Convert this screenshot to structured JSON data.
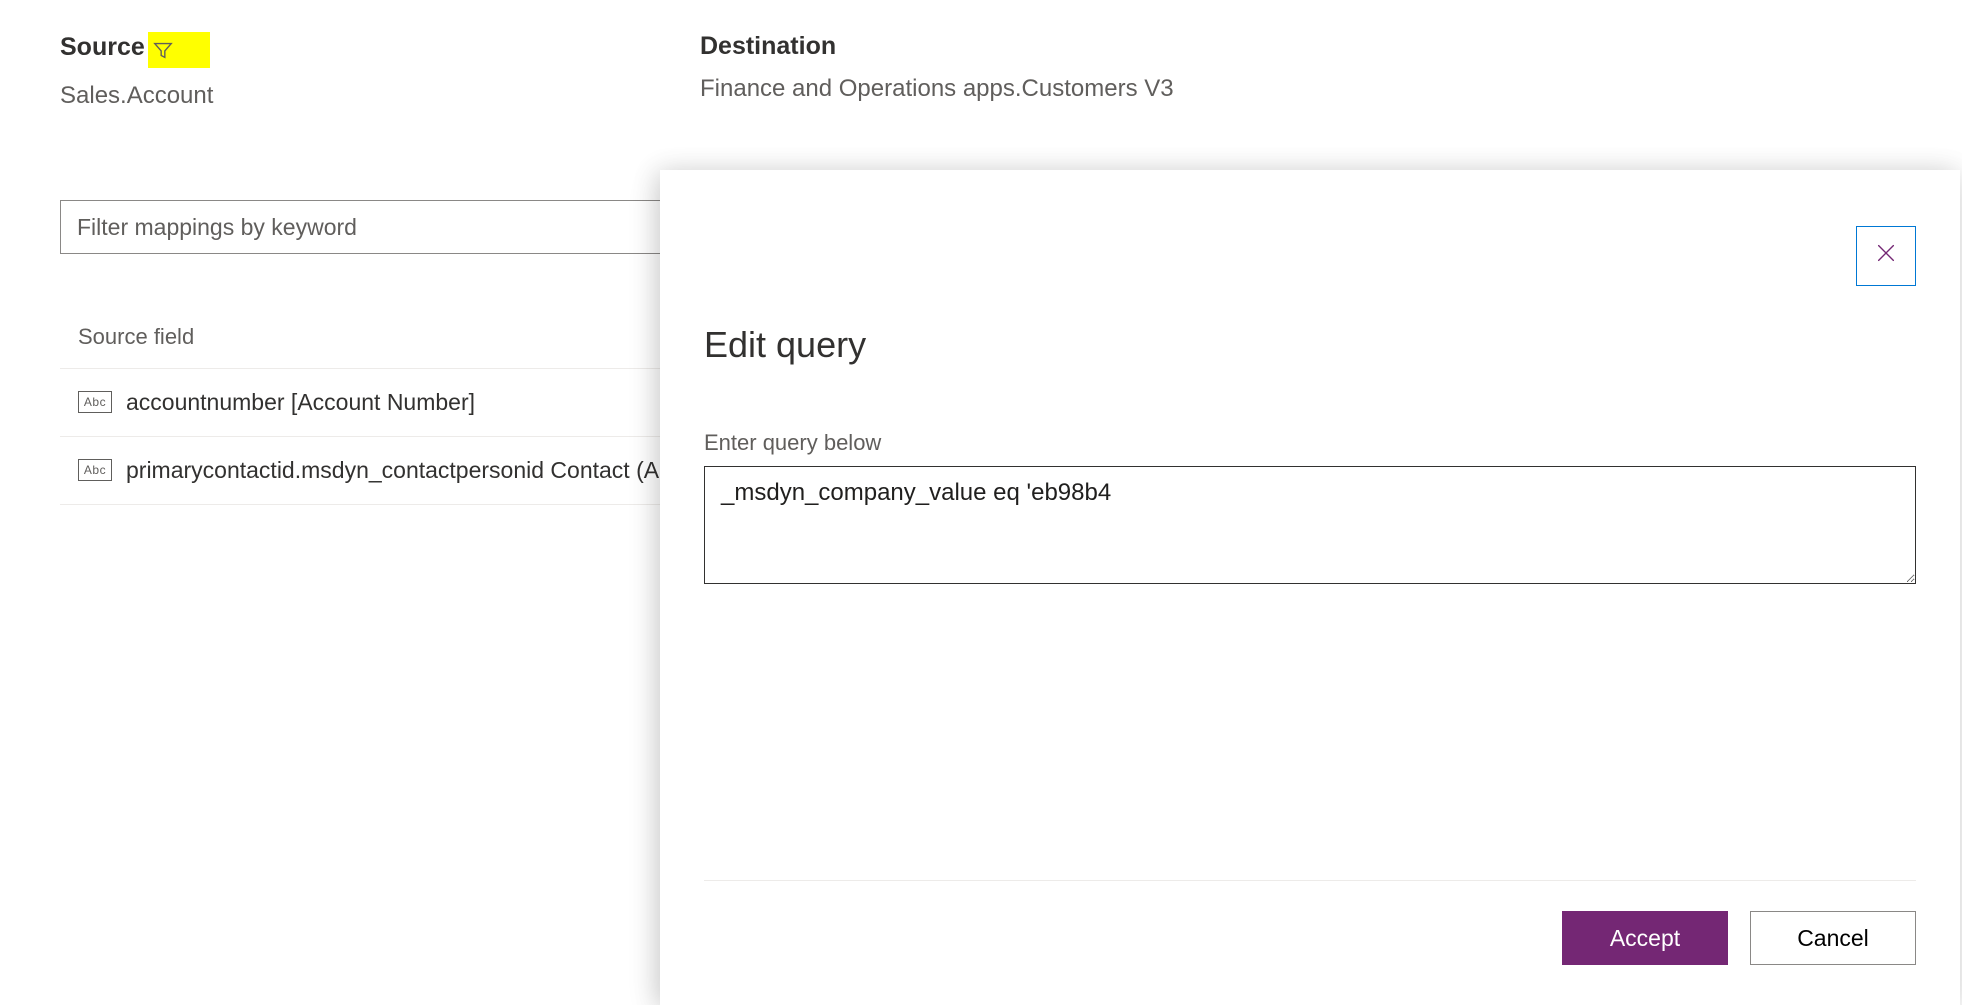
{
  "source": {
    "label": "Source",
    "value": "Sales.Account"
  },
  "destination": {
    "label": "Destination",
    "value": "Finance and Operations apps.Customers V3"
  },
  "filter": {
    "placeholder": "Filter mappings by keyword"
  },
  "listing": {
    "column_header": "Source field",
    "row1": "accountnumber [Account Number]",
    "row2": "primarycontactid.msdyn_contactpersonid Contact (Account Number/Contact Person ID)"
  },
  "modal": {
    "title": "Edit query",
    "field_label": "Enter query below",
    "query_value": "_msdyn_company_value eq 'eb98b4",
    "accept_label": "Accept",
    "cancel_label": "Cancel"
  },
  "icons": {
    "abc": "Abc"
  }
}
